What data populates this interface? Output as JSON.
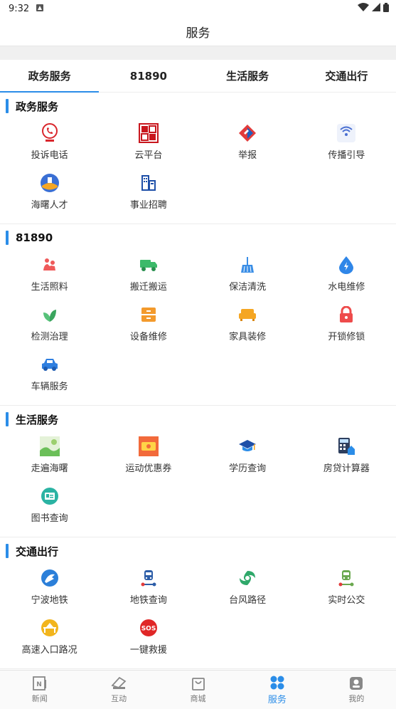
{
  "status": {
    "time": "9:32"
  },
  "header": {
    "title": "服务"
  },
  "tabs": [
    {
      "label": "政务服务",
      "active": true
    },
    {
      "label": "81890",
      "active": false
    },
    {
      "label": "生活服务",
      "active": false
    },
    {
      "label": "交通出行",
      "active": false
    }
  ],
  "sections": [
    {
      "title": "政务服务",
      "items": [
        {
          "label": "投诉电话",
          "icon": "phone-complaint-icon"
        },
        {
          "label": "云平台",
          "icon": "wenming-seal-icon"
        },
        {
          "label": "举报",
          "icon": "report-icon"
        },
        {
          "label": "传播引导",
          "icon": "broadcast-icon"
        },
        {
          "label": "海曙人才",
          "icon": "talent-icon"
        },
        {
          "label": "事业招聘",
          "icon": "recruitment-icon"
        }
      ]
    },
    {
      "title": "81890",
      "items": [
        {
          "label": "生活照料",
          "icon": "care-icon"
        },
        {
          "label": "搬迁搬运",
          "icon": "truck-icon"
        },
        {
          "label": "保洁清洗",
          "icon": "broom-icon"
        },
        {
          "label": "水电维修",
          "icon": "water-drop-icon"
        },
        {
          "label": "检测治理",
          "icon": "leaf-icon"
        },
        {
          "label": "设备维修",
          "icon": "cabinet-icon"
        },
        {
          "label": "家具装修",
          "icon": "sofa-icon"
        },
        {
          "label": "开锁修锁",
          "icon": "lock-icon"
        },
        {
          "label": "车辆服务",
          "icon": "car-icon"
        }
      ]
    },
    {
      "title": "生活服务",
      "items": [
        {
          "label": "走遍海曙",
          "icon": "travel-icon"
        },
        {
          "label": "运动优惠券",
          "icon": "coupon-icon"
        },
        {
          "label": "学历查询",
          "icon": "graduation-cap-icon"
        },
        {
          "label": "房贷计算器",
          "icon": "calculator-icon"
        },
        {
          "label": "图书查询",
          "icon": "library-card-icon"
        }
      ]
    },
    {
      "title": "交通出行",
      "items": [
        {
          "label": "宁波地铁",
          "icon": "metro-logo-icon"
        },
        {
          "label": "地铁查询",
          "icon": "metro-query-icon"
        },
        {
          "label": "台风路径",
          "icon": "typhoon-icon"
        },
        {
          "label": "实时公交",
          "icon": "bus-icon"
        },
        {
          "label": "高速入口路况",
          "icon": "highway-icon"
        },
        {
          "label": "一键救援",
          "icon": "sos-icon"
        }
      ]
    }
  ],
  "bottom_nav": [
    {
      "label": "新闻",
      "icon": "news-icon",
      "active": false
    },
    {
      "label": "互动",
      "icon": "interact-icon",
      "active": false
    },
    {
      "label": "商城",
      "icon": "shop-icon",
      "active": false
    },
    {
      "label": "服务",
      "icon": "services-icon",
      "active": true
    },
    {
      "label": "我的",
      "icon": "profile-icon",
      "active": false
    }
  ],
  "colors": {
    "accent": "#2b8de8"
  }
}
